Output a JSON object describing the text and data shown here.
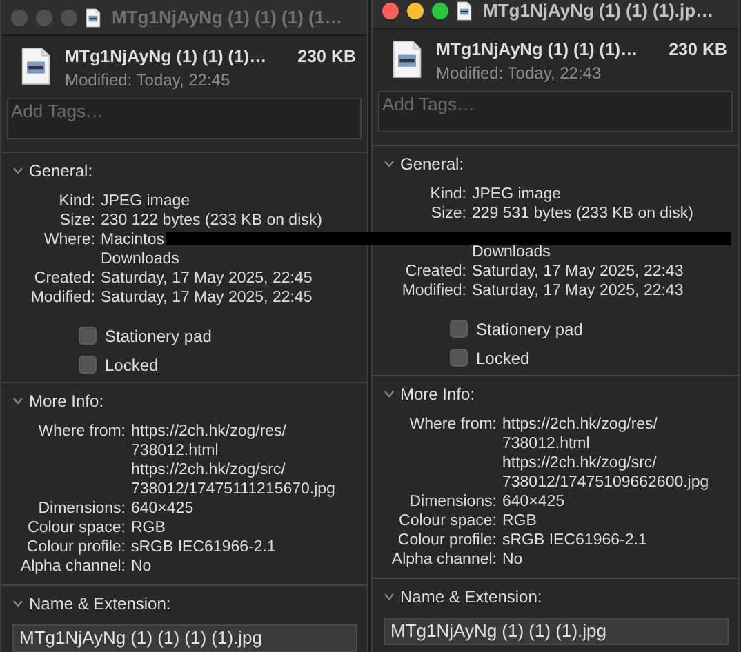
{
  "windows": [
    {
      "active": false,
      "title": "MTg1NjAyNg (1) (1) (1) (1…",
      "file_name": "MTg1NjAyNg (1) (1) (1)…",
      "size": "230 KB",
      "modified": "Modified: Today, 22:45",
      "tags_placeholder": "Add Tags…",
      "general": {
        "title": "General:",
        "expanded": true,
        "rows": [
          {
            "label": "Kind:",
            "lines": [
              "JPEG image"
            ]
          },
          {
            "label": "Size:",
            "lines": [
              "230 122 bytes (233 KB on disk)"
            ]
          },
          {
            "label": "Where:",
            "lines": [
              "Macintos",
              "Downloads"
            ]
          },
          {
            "label": "Created:",
            "lines": [
              "Saturday, 17 May 2025, 22:45"
            ]
          },
          {
            "label": "Modified:",
            "lines": [
              "Saturday, 17 May 2025, 22:45"
            ]
          }
        ],
        "checkboxes": [
          {
            "label": "Stationery pad",
            "checked": false
          },
          {
            "label": "Locked",
            "checked": false
          }
        ]
      },
      "more_info": {
        "title": "More Info:",
        "expanded": true,
        "rows": [
          {
            "label": "Where from:",
            "lines": [
              "https://2ch.hk/zog/res/",
              "738012.html",
              "https://2ch.hk/zog/src/",
              "738012/17475111215670.jpg"
            ]
          },
          {
            "label": "Dimensions:",
            "lines": [
              "640×425"
            ]
          },
          {
            "label": "Colour space:",
            "lines": [
              "RGB"
            ]
          },
          {
            "label": "Colour profile:",
            "lines": [
              "sRGB IEC61966-2.1"
            ]
          },
          {
            "label": "Alpha channel:",
            "lines": [
              "No"
            ]
          }
        ]
      },
      "name_extension": {
        "title": "Name & Extension:",
        "expanded": true,
        "value": "MTg1NjAyNg (1) (1) (1) (1).jpg"
      }
    },
    {
      "active": true,
      "title": "MTg1NjAyNg (1) (1) (1).jp…",
      "file_name": "MTg1NjAyNg (1) (1) (1)…",
      "size": "230 KB",
      "modified": "Modified: Today, 22:43",
      "tags_placeholder": "Add Tags…",
      "general": {
        "title": "General:",
        "expanded": true,
        "rows": [
          {
            "label": "Kind:",
            "lines": [
              "JPEG image"
            ]
          },
          {
            "label": "Size:",
            "lines": [
              "229 531 bytes (233 KB on disk)"
            ]
          },
          {
            "lines": [
              "Downloads"
            ]
          },
          {
            "label": "Created:",
            "lines": [
              "Saturday, 17 May 2025, 22:43"
            ]
          },
          {
            "label": "Modified:",
            "lines": [
              "Saturday, 17 May 2025, 22:43"
            ]
          }
        ],
        "checkboxes": [
          {
            "label": "Stationery pad",
            "checked": false
          },
          {
            "label": "Locked",
            "checked": false
          }
        ]
      },
      "more_info": {
        "title": "More Info:",
        "expanded": true,
        "rows": [
          {
            "label": "Where from:",
            "lines": [
              "https://2ch.hk/zog/res/",
              "738012.html",
              "https://2ch.hk/zog/src/",
              "738012/17475109662600.jpg"
            ]
          },
          {
            "label": "Dimensions:",
            "lines": [
              "640×425"
            ]
          },
          {
            "label": "Colour space:",
            "lines": [
              "RGB"
            ]
          },
          {
            "label": "Colour profile:",
            "lines": [
              "sRGB IEC61966-2.1"
            ]
          },
          {
            "label": "Alpha channel:",
            "lines": [
              "No"
            ]
          }
        ]
      },
      "name_extension": {
        "title": "Name & Extension:",
        "expanded": true,
        "value": "MTg1NjAyNg (1) (1) (1).jpg"
      }
    }
  ]
}
